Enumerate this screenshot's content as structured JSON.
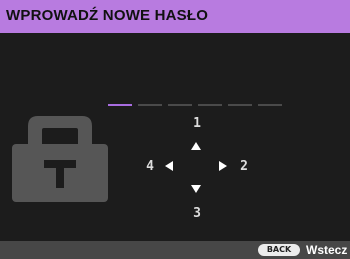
{
  "dialog": {
    "title": "WPROWADŹ NOWE HASŁO"
  },
  "password": {
    "slots_total": 6,
    "slots_filled": 0,
    "active_color": "#a86de0",
    "inactive_color": "#4a4a4a"
  },
  "keypad": {
    "up": "1",
    "right": "2",
    "down": "3",
    "left": "4"
  },
  "icons": {
    "lock": "lock-icon",
    "up": "arrow-up-icon",
    "down": "arrow-down-icon",
    "left": "arrow-left-icon",
    "right": "arrow-right-icon"
  },
  "footer": {
    "back_key": "BACK",
    "back_label": "Wstecz"
  },
  "colors": {
    "title_bar": "#b87be0",
    "background": "#1c1c1c",
    "footer_bar": "#474747"
  }
}
